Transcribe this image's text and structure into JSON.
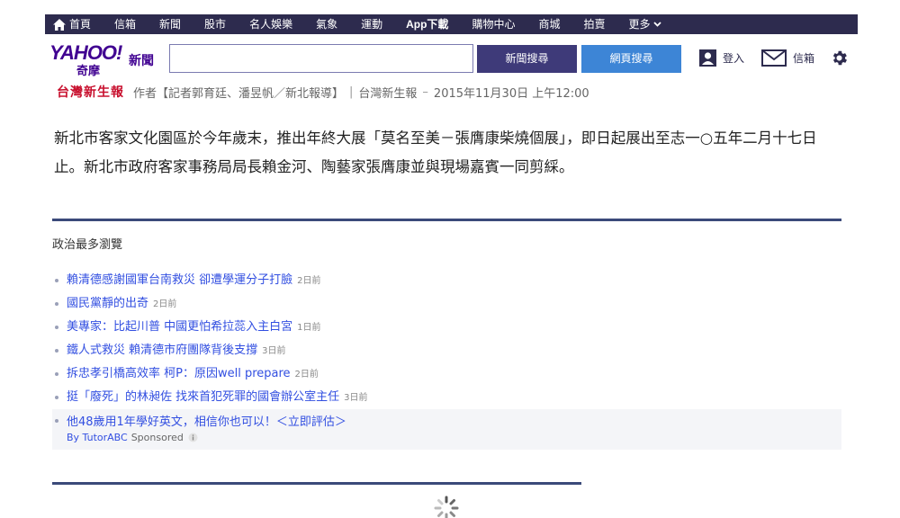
{
  "nav": {
    "items": [
      {
        "label": "首頁"
      },
      {
        "label": "信箱"
      },
      {
        "label": "新聞"
      },
      {
        "label": "股市"
      },
      {
        "label": "名人娛樂"
      },
      {
        "label": "氣象"
      },
      {
        "label": "運動"
      },
      {
        "label": "App下載"
      },
      {
        "label": "購物中心"
      },
      {
        "label": "商城"
      },
      {
        "label": "拍賣"
      },
      {
        "label": "更多"
      }
    ]
  },
  "header": {
    "logo_text": "YAHOO!",
    "logo_sub": "奇摩",
    "logo_section": "新聞",
    "search_value": "",
    "search_news_label": "新聞搜尋",
    "search_web_label": "網頁搜尋",
    "login_label": "登入",
    "mail_label": "信箱"
  },
  "byline": {
    "source_logo": "台灣新生報",
    "author": "作者【記者郭育廷、潘昱帆／新北報導】",
    "source": "台灣新生報",
    "datetime": "2015年11月30日 上午12:00"
  },
  "article": {
    "body": "新北市客家文化園區於今年歲末，推出年終大展「莫名至美－張膺康柴燒個展」，即日起展出至志一○五年二月十七日止。新北市政府客家事務局局長賴金河、陶藝家張膺康並與現場嘉賓一同剪綵。"
  },
  "most_viewed": {
    "title": "政治最多瀏覽",
    "items": [
      {
        "headline": "賴清德感謝國軍台南救災 卻遭學運分子打臉",
        "ago": "2日前"
      },
      {
        "headline": "國民黨靜的出奇",
        "ago": "2日前"
      },
      {
        "headline": "美專家：比起川普 中國更怕希拉蕊入主白宮",
        "ago": "1日前"
      },
      {
        "headline": "鐵人式救災 賴清德市府團隊背後支撐",
        "ago": "3日前"
      },
      {
        "headline": "拆忠孝引橋高效率 柯P：原因well prepare",
        "ago": "2日前"
      },
      {
        "headline": "挺「廢死」的林昶佐 找來首犯死罪的國會辦公室主任",
        "ago": "3日前"
      }
    ],
    "sponsored": {
      "headline": "他48歲用1年學好英文，相信你也可以！＜立即評估＞",
      "by": "By TutorABC",
      "label": "Sponsored"
    }
  },
  "colors": {
    "nav_bg": "#2d2b4e",
    "brand": "#400191",
    "link": "#324fe1",
    "rule": "#3b4a7a",
    "btn_news": "#3e3a79",
    "btn_web": "#3d85d6"
  }
}
